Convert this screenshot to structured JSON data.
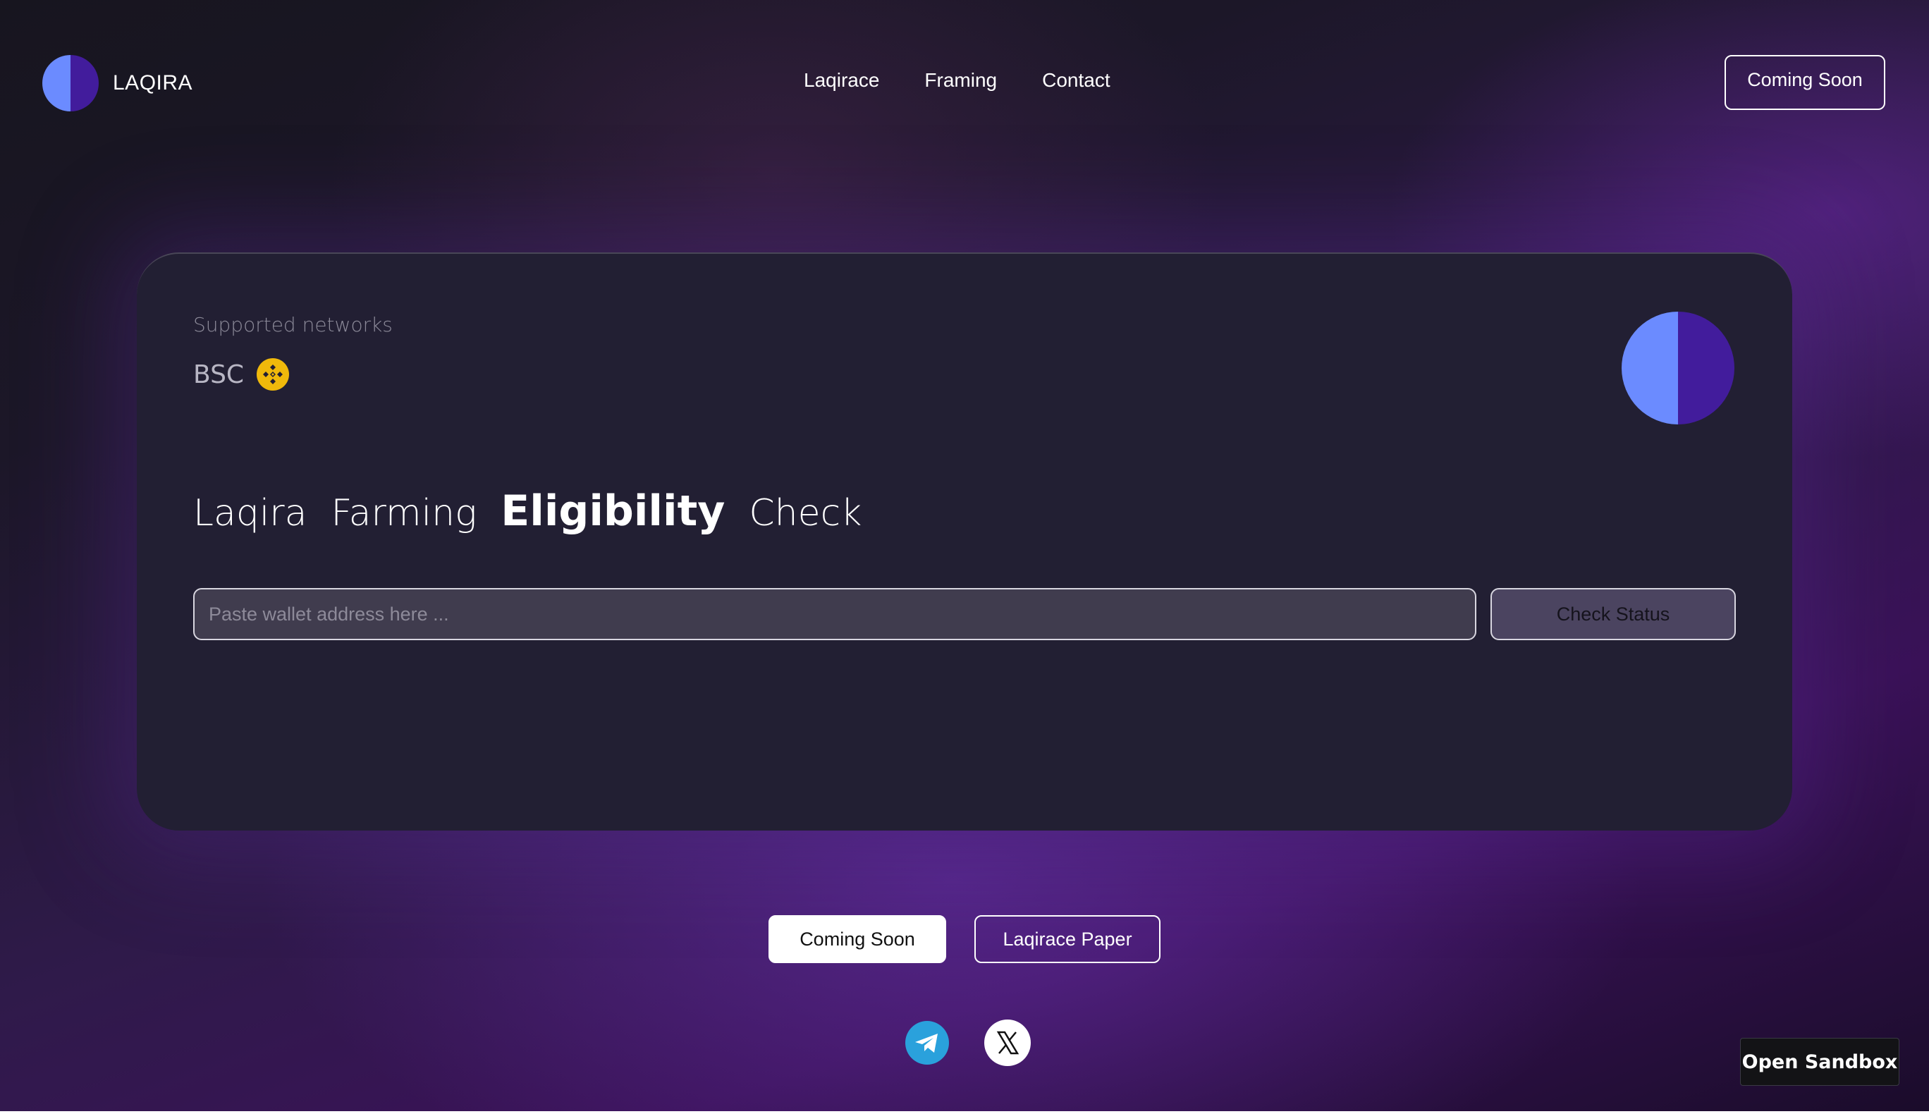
{
  "header": {
    "brand": "LAQIRA",
    "nav": [
      "Laqirace",
      "Framing",
      "Contact"
    ],
    "cta": "Coming Soon"
  },
  "card": {
    "supported_label": "Supported networks",
    "network": "BSC",
    "headline": [
      "Laqira",
      "Farming",
      "Eligibility",
      "Check"
    ],
    "input_placeholder": "Paste wallet address here ...",
    "check_button": "Check Status"
  },
  "footer": {
    "primary_button": "Coming Soon",
    "secondary_button": "Laqirace Paper",
    "socials": [
      "telegram-icon",
      "x-icon"
    ]
  },
  "sandbox_button": "Open Sandbox",
  "colors": {
    "logo_left": "#6b8bff",
    "logo_right": "#421c9c",
    "bnb": "#f0b90b",
    "telegram": "#2aa1dc"
  }
}
